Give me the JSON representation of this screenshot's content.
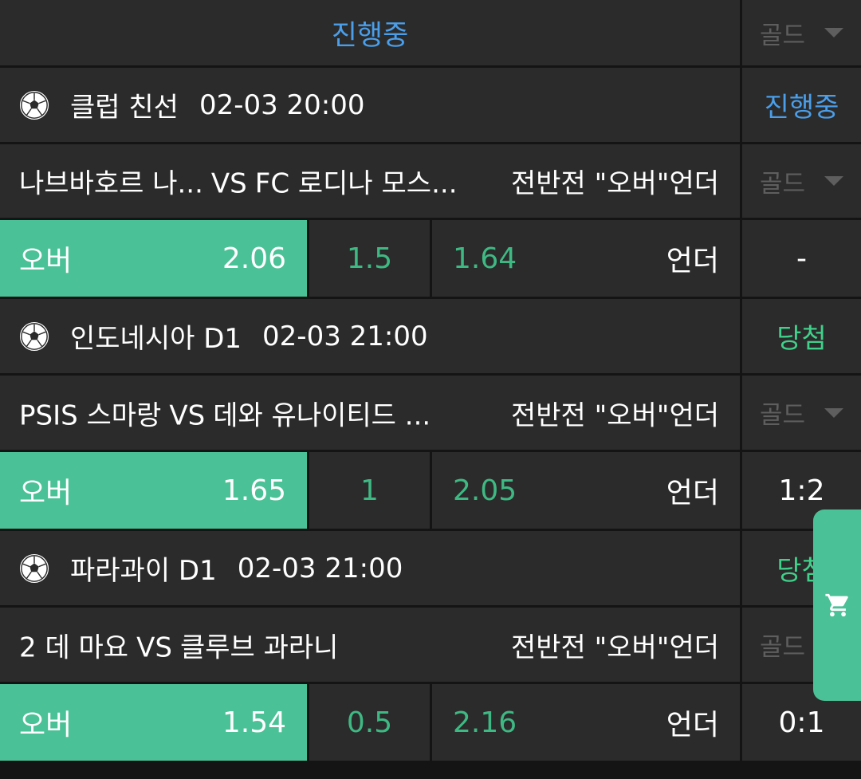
{
  "header": {
    "title": "진행중",
    "gold_label": "골드"
  },
  "matches": [
    {
      "league": "클럽 친선",
      "time": "02-03 20:00",
      "status": "진행중",
      "home": "나브바호르 나...",
      "vs": "VS",
      "away": "FC 로디나 모스...",
      "market": "전반전 \"오버\"언더",
      "gold_label": "골드",
      "over_label": "오버",
      "over_odds": "2.06",
      "line": "1.5",
      "under_odds": "1.64",
      "under_label": "언더",
      "score": "-"
    },
    {
      "league": "인도네시아 D1",
      "time": "02-03 21:00",
      "status": "당첨",
      "home": "PSIS 스마랑",
      "vs": "VS",
      "away": "데와 유나이티드 ...",
      "market": "전반전 \"오버\"언더",
      "gold_label": "골드",
      "over_label": "오버",
      "over_odds": "1.65",
      "line": "1",
      "under_odds": "2.05",
      "under_label": "언더",
      "score": "1:2"
    },
    {
      "league": "파라과이 D1",
      "time": "02-03 21:00",
      "status": "당첨",
      "home": "2 데 마요",
      "vs": "VS",
      "away": "클루브 과라니",
      "market": "전반전 \"오버\"언더",
      "gold_label": "골드",
      "over_label": "오버",
      "over_odds": "1.54",
      "line": "0.5",
      "under_odds": "2.16",
      "under_label": "언더",
      "score": "0:1"
    }
  ],
  "colors": {
    "accent_blue": "#4a9eea",
    "win_green": "#3fd18a",
    "over_bg": "#4ac196",
    "panel_bg": "#2b2b2b"
  },
  "icons": {
    "sport": "soccer-ball-icon",
    "cart": "shopping-cart-icon",
    "dropdown": "caret-down-icon"
  }
}
